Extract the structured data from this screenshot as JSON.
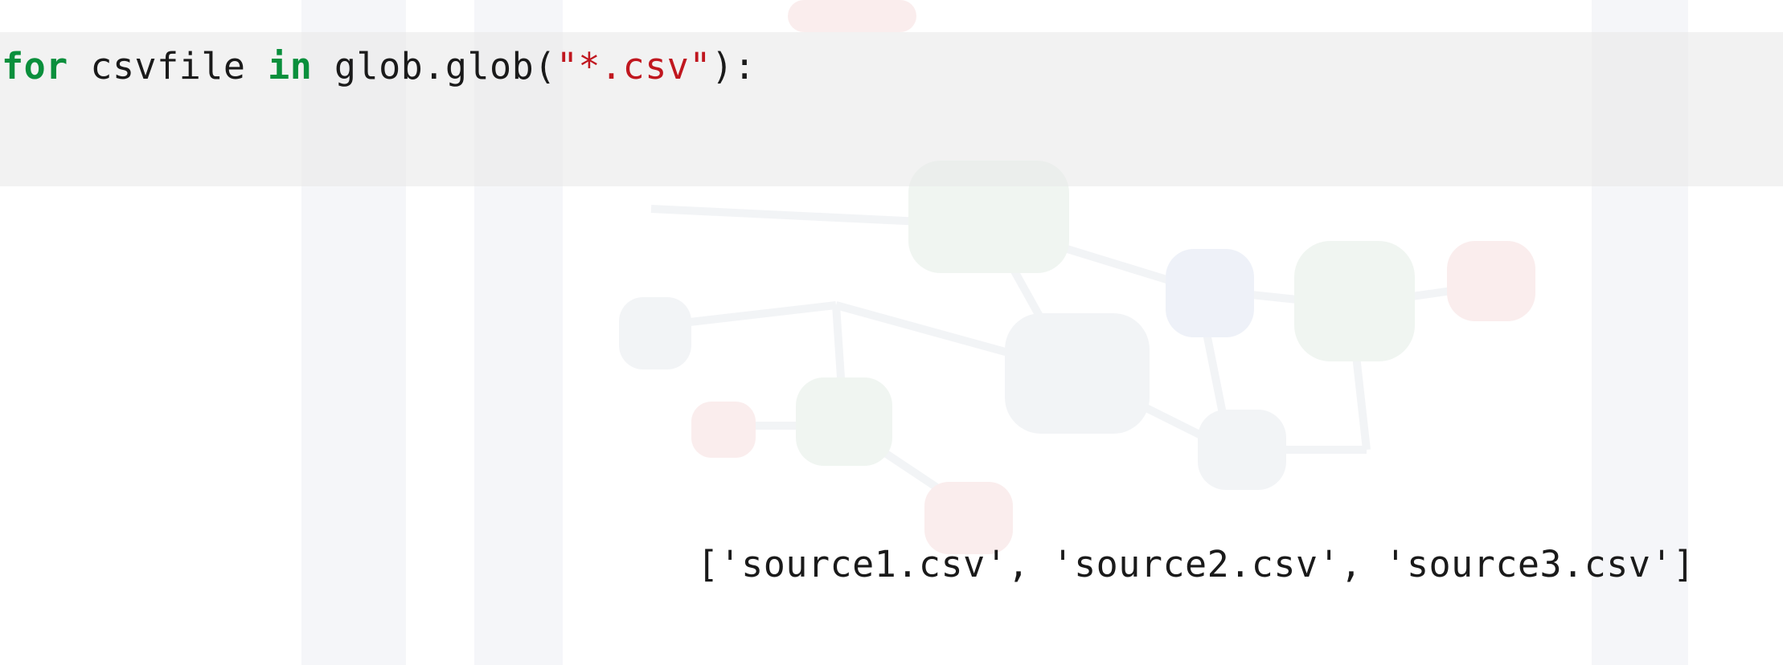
{
  "code_cell": {
    "tokens": {
      "kw_for": "for",
      "var_csvfile": " csvfile ",
      "kw_in": "in",
      "call_glob": " glob.glob(",
      "str_pattern": "\"*.csv\"",
      "close": "):"
    }
  },
  "output": {
    "text": "['source1.csv', 'source2.csv', 'source3.csv']"
  },
  "colors": {
    "keyword": "#0a8f3c",
    "string": "#c0171f",
    "text": "#1a1a1a",
    "cell_background": "#f2f2f2"
  }
}
